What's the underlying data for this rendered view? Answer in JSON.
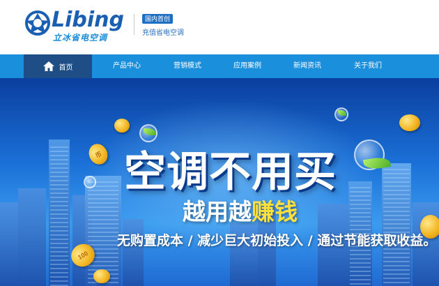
{
  "brand": {
    "name": "Libing",
    "sub": "立冰省电空调",
    "badge": "国内首创",
    "tagline": "充值省电空调",
    "colors": {
      "primary": "#1b5fb3",
      "nav": "#1a8fdb",
      "nav_active": "#1f4d86",
      "highlight": "#ffe13a"
    }
  },
  "nav": {
    "home": {
      "label": "首页",
      "icon": "home-icon"
    },
    "items": [
      {
        "label": "产品中心"
      },
      {
        "label": "营销模式"
      },
      {
        "label": "应用案例"
      },
      {
        "label": "新闻资讯"
      },
      {
        "label": "关于我们"
      }
    ]
  },
  "banner": {
    "headline": "空调不用买",
    "sub_part1": "越用越",
    "sub_part2": "赚钱",
    "bottom": "无购置成本 / 减少巨大初始投入 / 通过节能获取收益。",
    "coin_text_a": "100",
    "coin_text_b": "币"
  }
}
